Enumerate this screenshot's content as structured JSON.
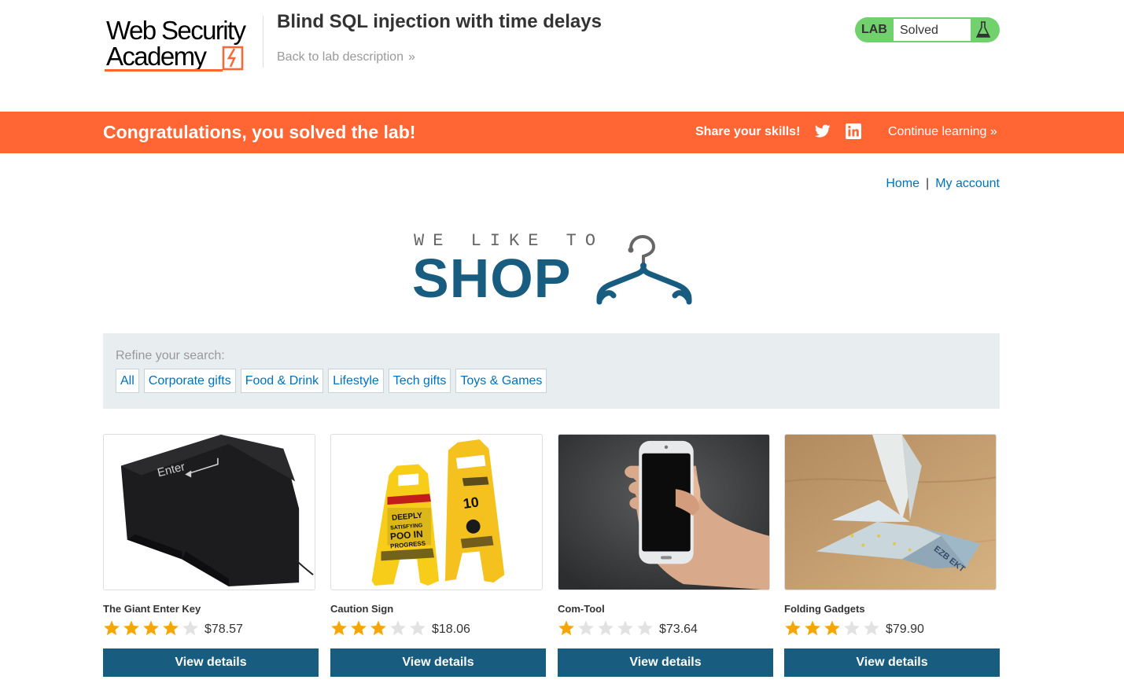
{
  "header": {
    "logo_line1": "Web Security",
    "logo_line2": "Academy",
    "lab_title": "Blind SQL injection with time delays",
    "back_link": "Back to lab description",
    "back_chevron": "»",
    "lab_badge": "LAB",
    "lab_status": "Solved",
    "brand_orange": "#ff6633",
    "status_green": "#70d16d"
  },
  "notification": {
    "message": "Congratulations, you solved the lab!",
    "share_label": "Share your skills!",
    "twitter_icon": "twitter-icon",
    "linkedin_icon": "linkedin-icon",
    "continue_label": "Continue learning",
    "continue_chevron": "»"
  },
  "nav": {
    "home": "Home",
    "separator": "|",
    "my_account": "My account"
  },
  "shop_logo": {
    "tagline": "WE LIKE TO",
    "word": "SHOP",
    "brand_blue": "#185c80"
  },
  "filters": {
    "label": "Refine your search:",
    "items": [
      "All",
      "Corporate gifts",
      "Food & Drink",
      "Lifestyle",
      "Tech gifts",
      "Toys & Games"
    ]
  },
  "products": [
    {
      "name": "The Giant Enter Key",
      "rating": 4,
      "max_rating": 5,
      "price": "$78.57",
      "button": "View details",
      "image": "giant-enter-key-image"
    },
    {
      "name": "Caution Sign",
      "rating": 3,
      "max_rating": 5,
      "price": "$18.06",
      "button": "View details",
      "image": "caution-sign-image"
    },
    {
      "name": "Com-Tool",
      "rating": 1,
      "max_rating": 5,
      "price": "$73.64",
      "button": "View details",
      "image": "phone-in-hand-image"
    },
    {
      "name": "Folding Gadgets",
      "rating": 3,
      "max_rating": 5,
      "price": "$79.90",
      "button": "View details",
      "image": "origami-banknote-image"
    }
  ]
}
